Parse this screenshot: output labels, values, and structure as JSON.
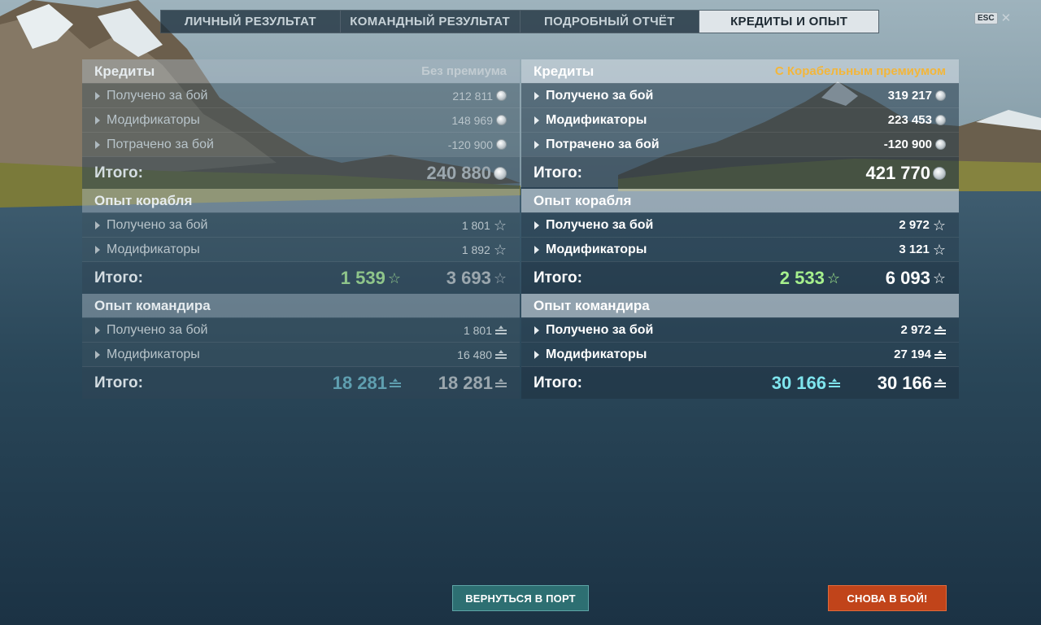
{
  "tabs": [
    {
      "label": "ЛИЧНЫЙ РЕЗУЛЬТАТ",
      "active": false
    },
    {
      "label": "КОМАНДНЫЙ РЕЗУЛЬТАТ",
      "active": false
    },
    {
      "label": "ПОДРОБНЫЙ ОТЧЁТ",
      "active": false
    },
    {
      "label": "КРЕДИТЫ И ОПЫТ",
      "active": true
    }
  ],
  "esc": {
    "key": "ESC",
    "close": "✕"
  },
  "left": {
    "credits": {
      "title": "Кредиты",
      "subtitle": "Без премиума",
      "rows": [
        {
          "label": "Получено за бой",
          "value": "212 811"
        },
        {
          "label": "Модификаторы",
          "value": "148 969"
        },
        {
          "label": "Потрачено за бой",
          "value": "-120 900"
        }
      ],
      "total_label": "Итого:",
      "total": "240 880"
    },
    "ship_xp": {
      "title": "Опыт корабля",
      "rows": [
        {
          "label": "Получено за бой",
          "value": "1 801"
        },
        {
          "label": "Модификаторы",
          "value": "1 892"
        }
      ],
      "total_label": "Итого:",
      "total_free": "1 539",
      "total": "3 693"
    },
    "commander_xp": {
      "title": "Опыт командира",
      "rows": [
        {
          "label": "Получено за бой",
          "value": "1 801"
        },
        {
          "label": "Модификаторы",
          "value": "16 480"
        }
      ],
      "total_label": "Итого:",
      "total_free": "18 281",
      "total": "18 281"
    }
  },
  "right": {
    "credits": {
      "title": "Кредиты",
      "subtitle": "С Корабельным премиумом",
      "rows": [
        {
          "label": "Получено за бой",
          "value": "319 217"
        },
        {
          "label": "Модификаторы",
          "value": "223 453"
        },
        {
          "label": "Потрачено за бой",
          "value": "-120 900"
        }
      ],
      "total_label": "Итого:",
      "total": "421 770"
    },
    "ship_xp": {
      "title": "Опыт корабля",
      "rows": [
        {
          "label": "Получено за бой",
          "value": "2 972"
        },
        {
          "label": "Модификаторы",
          "value": "3 121"
        }
      ],
      "total_label": "Итого:",
      "total_free": "2 533",
      "total": "6 093"
    },
    "commander_xp": {
      "title": "Опыт командира",
      "rows": [
        {
          "label": "Получено за бой",
          "value": "2 972"
        },
        {
          "label": "Модификаторы",
          "value": "27 194"
        }
      ],
      "total_label": "Итого:",
      "total_free": "30 166",
      "total": "30 166"
    }
  },
  "buttons": {
    "port": "ВЕРНУТЬСЯ В ПОРТ",
    "battle": "СНОВА В БОЙ!"
  },
  "icons": {
    "credits": "silver-coin-icon",
    "ship_xp": "star-icon",
    "commander_xp": "commander-xp-icon"
  },
  "colors": {
    "premium_subtitle": "#f3b63a",
    "free_xp_green": "#a6f08d",
    "commander_free_teal": "#7fe5ee",
    "battle_button": "#c1441a",
    "port_button": "#2d6f72"
  }
}
